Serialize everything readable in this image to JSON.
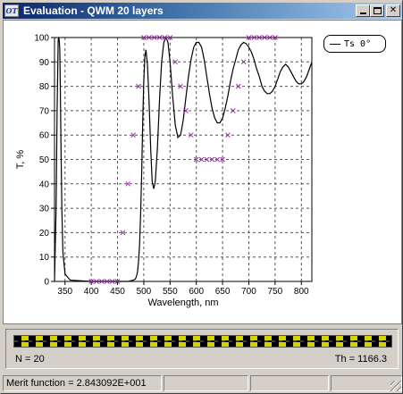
{
  "window": {
    "title": "Evaluation - QWM 20 layers",
    "icon_label": "OT",
    "buttons": [
      "minimize-icon",
      "maximize-icon",
      "close-icon"
    ]
  },
  "chart_data": {
    "type": "line",
    "xlabel": "Wavelength, nm",
    "ylabel": "T, %",
    "xlim": [
      330,
      820
    ],
    "ylim": [
      0,
      100
    ],
    "x_ticks": [
      350,
      400,
      450,
      500,
      550,
      600,
      650,
      700,
      750,
      800
    ],
    "y_ticks": [
      0,
      10,
      20,
      30,
      40,
      50,
      60,
      70,
      80,
      90,
      100
    ],
    "grid": true,
    "legend": {
      "position": "top-right",
      "entries": [
        "Ts 0°"
      ]
    },
    "series": [
      {
        "name": "Ts 0°",
        "style": "line",
        "color": "#000000",
        "x": [
          330,
          333,
          335,
          337,
          338,
          339,
          340,
          341,
          342,
          344,
          346,
          350,
          360,
          400,
          450,
          470,
          480,
          484,
          486,
          488,
          490,
          492,
          494,
          496,
          498,
          500,
          502,
          504,
          507,
          510,
          513,
          516,
          519,
          522,
          526,
          530,
          534,
          538,
          542,
          546,
          550,
          555,
          560,
          565,
          570,
          575,
          580,
          585,
          590,
          595,
          600,
          605,
          610,
          615,
          620,
          625,
          630,
          635,
          640,
          645,
          650,
          655,
          660,
          665,
          670,
          675,
          680,
          685,
          690,
          695,
          700,
          705,
          710,
          715,
          720,
          725,
          730,
          735,
          740,
          745,
          750,
          755,
          760,
          765,
          770,
          775,
          780,
          785,
          790,
          795,
          800,
          805,
          810,
          815,
          820
        ],
        "y": [
          0,
          30,
          70,
          99,
          100,
          99,
          95,
          80,
          60,
          30,
          12,
          3,
          0.5,
          0,
          0,
          0,
          0.5,
          1,
          2,
          4,
          8,
          15,
          28,
          45,
          65,
          82,
          92,
          95,
          89,
          74,
          55,
          41,
          38,
          41,
          55,
          75,
          90,
          98,
          100,
          98,
          90,
          76,
          64,
          59,
          60,
          66,
          75,
          84,
          91,
          96,
          98,
          98,
          96,
          91,
          84,
          77,
          71,
          67,
          65,
          65,
          67,
          71,
          76,
          82,
          87,
          91,
          95,
          97,
          98,
          97.5,
          96,
          94,
          91,
          87,
          84,
          80,
          78,
          77,
          77,
          78,
          80,
          83,
          86,
          88,
          89,
          88,
          86,
          84,
          82,
          81,
          81,
          82,
          84,
          87,
          90
        ]
      },
      {
        "name": "",
        "style": "markers",
        "color": "#9a2aa8",
        "x": [
          400,
          410,
          420,
          430,
          440,
          450,
          460,
          470,
          480,
          490,
          500,
          510,
          520,
          530,
          540,
          550,
          560,
          570,
          580,
          590,
          600,
          610,
          620,
          630,
          640,
          650,
          660,
          670,
          680,
          690,
          700,
          710,
          720,
          730,
          740,
          750
        ],
        "y": [
          0,
          0,
          0,
          0,
          0,
          0,
          20,
          40,
          60,
          80,
          100,
          100,
          100,
          100,
          100,
          100,
          90,
          80,
          70,
          60,
          50,
          50,
          50,
          50,
          50,
          50,
          60,
          70,
          80,
          90,
          100,
          100,
          100,
          100,
          100,
          100
        ]
      }
    ]
  },
  "status": {
    "n_text": "N = 20",
    "th_text": "Th = 1166.3"
  },
  "statusbar": {
    "merit_text": "Merit function =  2.843092E+001"
  }
}
